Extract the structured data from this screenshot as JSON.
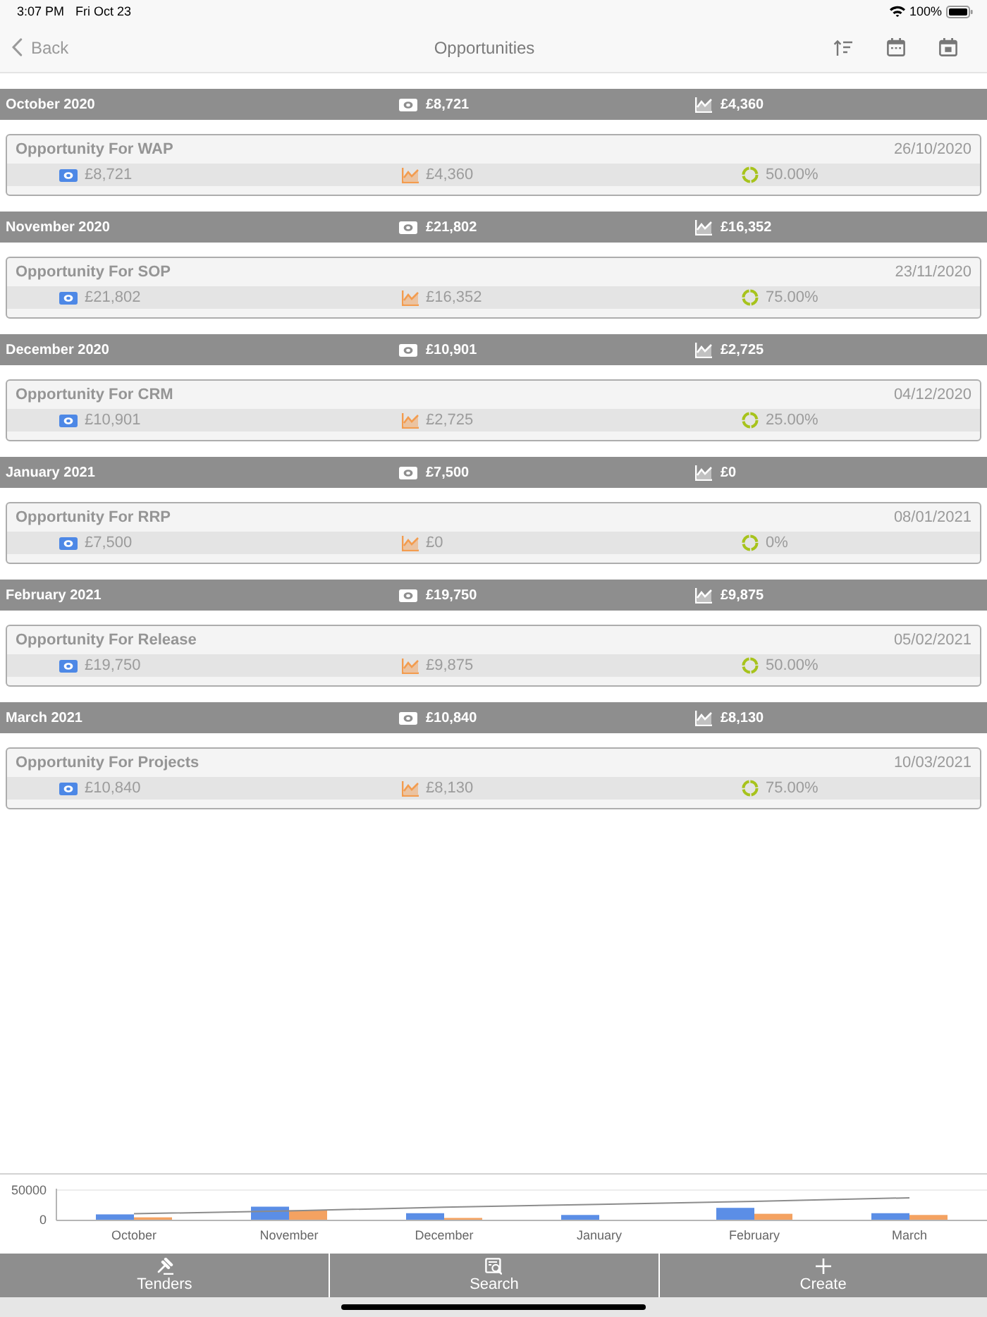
{
  "status_bar": {
    "time": "3:07 PM",
    "date": "Fri Oct 23",
    "battery": "100%"
  },
  "nav_bar": {
    "back": "Back",
    "title": "Opportunities"
  },
  "months": [
    {
      "label": "October 2020",
      "value": "£8,721",
      "weighted": "£4,360",
      "opportunities": [
        {
          "name": "Opportunity For WAP",
          "date": "26/10/2020",
          "value": "£8,721",
          "weighted": "£4,360",
          "probability": "50.00%"
        }
      ]
    },
    {
      "label": "November 2020",
      "value": "£21,802",
      "weighted": "£16,352",
      "opportunities": [
        {
          "name": "Opportunity For SOP",
          "date": "23/11/2020",
          "value": "£21,802",
          "weighted": "£16,352",
          "probability": "75.00%"
        }
      ]
    },
    {
      "label": "December 2020",
      "value": "£10,901",
      "weighted": "£2,725",
      "opportunities": [
        {
          "name": "Opportunity For CRM",
          "date": "04/12/2020",
          "value": "£10,901",
          "weighted": "£2,725",
          "probability": "25.00%"
        }
      ]
    },
    {
      "label": "January 2021",
      "value": "£7,500",
      "weighted": "£0",
      "opportunities": [
        {
          "name": "Opportunity For RRP",
          "date": "08/01/2021",
          "value": "£7,500",
          "weighted": "£0",
          "probability": "0%"
        }
      ]
    },
    {
      "label": "February 2021",
      "value": "£19,750",
      "weighted": "£9,875",
      "opportunities": [
        {
          "name": "Opportunity For Release",
          "date": "05/02/2021",
          "value": "£19,750",
          "weighted": "£9,875",
          "probability": "50.00%"
        }
      ]
    },
    {
      "label": "March 2021",
      "value": "£10,840",
      "weighted": "£8,130",
      "opportunities": [
        {
          "name": "Opportunity For Projects",
          "date": "10/03/2021",
          "value": "£10,840",
          "weighted": "£8,130",
          "probability": "75.00%"
        }
      ]
    }
  ],
  "chart": {
    "chart_data": {
      "type": "bar",
      "categories": [
        "October",
        "November",
        "December",
        "January",
        "February",
        "March"
      ],
      "series": [
        {
          "color": "#5b8ee6",
          "values": [
            9000,
            22000,
            11000,
            8000,
            20000,
            11000
          ]
        },
        {
          "color": "#f4a261",
          "values": [
            4000,
            16000,
            3000,
            0,
            10000,
            8000
          ]
        },
        {
          "type": "line",
          "color": "#8c8c8c",
          "values": [
            10000,
            15000,
            21000,
            26000,
            31000,
            37000
          ]
        }
      ],
      "stacked": false,
      "ylim": [
        0,
        50000
      ],
      "yticks": [
        0,
        50000
      ]
    }
  },
  "tab_bar": {
    "tabs": [
      {
        "label": "Tenders"
      },
      {
        "label": "Search"
      },
      {
        "label": "Create"
      }
    ]
  }
}
